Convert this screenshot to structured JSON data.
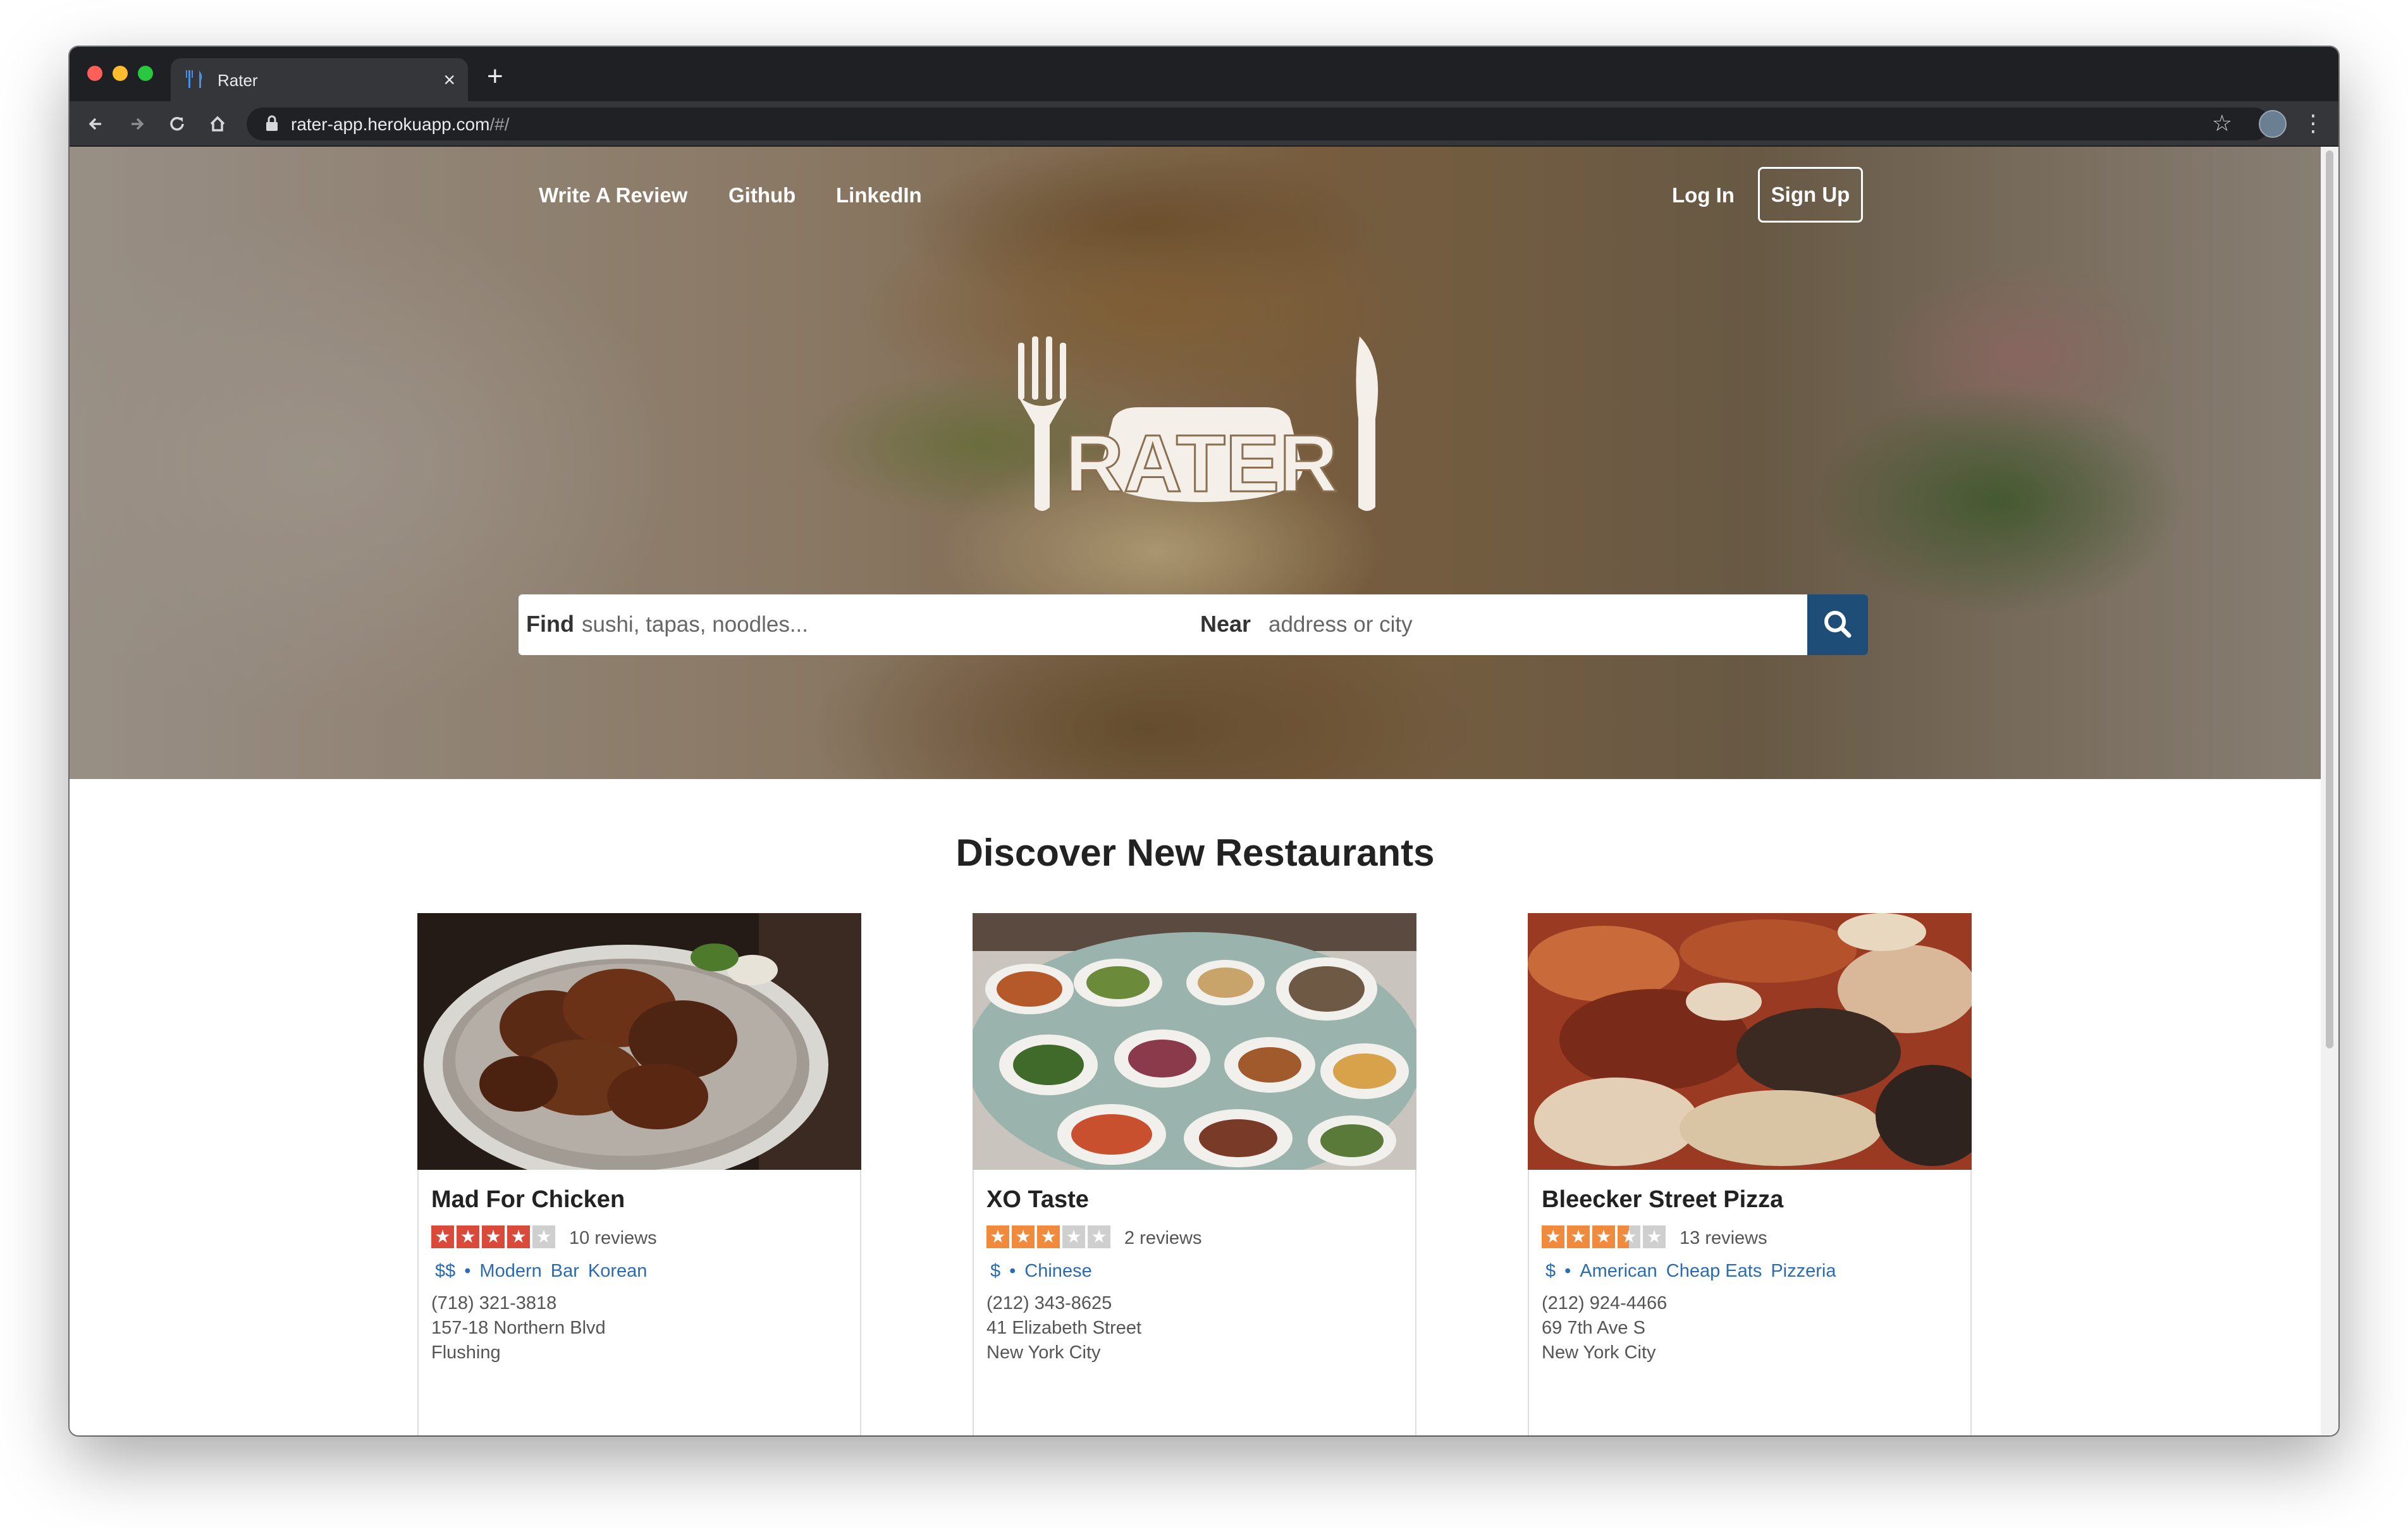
{
  "browser": {
    "tab_title": "Rater",
    "tab_close": "×",
    "new_tab": "+",
    "url_main": "rater-app.herokuapp.com",
    "url_rest": "/#/",
    "icons": {
      "back": "back-arrow-icon",
      "forward": "forward-arrow-icon",
      "reload": "reload-icon",
      "home": "home-icon",
      "lock": "lock-icon",
      "bookmark": "star-icon",
      "menu": "kebab-menu-icon"
    }
  },
  "nav": {
    "write_review": "Write A Review",
    "github": "Github",
    "linkedin": "LinkedIn",
    "login": "Log In",
    "signup": "Sign Up"
  },
  "logo": {
    "text": "RATER"
  },
  "search": {
    "find_label": "Find",
    "find_placeholder": "sushi, tapas, noodles...",
    "near_label": "Near",
    "near_placeholder": "address or city",
    "button_color": "#1e4d78"
  },
  "section_title": "Discover New Restaurants",
  "colors": {
    "link": "#2b6cb0",
    "star_red": "#d94a3a",
    "star_orange": "#f08a3c",
    "star_empty": "#cfcfcf"
  },
  "restaurants": [
    {
      "name": "Mad For Chicken",
      "rating": 4,
      "reviews": "10 reviews",
      "price": "$$",
      "separator": "•",
      "categories": [
        "Modern",
        "Bar",
        "Korean"
      ],
      "phone": "(718) 321-3818",
      "address": "157-18 Northern Blvd",
      "city": "Flushing"
    },
    {
      "name": "XO Taste",
      "rating": 3,
      "reviews": "2 reviews",
      "price": "$",
      "separator": "•",
      "categories": [
        "Chinese"
      ],
      "phone": "(212) 343-8625",
      "address": "41 Elizabeth Street",
      "city": "New York City"
    },
    {
      "name": "Bleecker Street Pizza",
      "rating": 3.5,
      "reviews": "13 reviews",
      "price": "$",
      "separator": "•",
      "categories": [
        "American",
        "Cheap Eats",
        "Pizzeria"
      ],
      "phone": "(212) 924-4466",
      "address": "69 7th Ave S",
      "city": "New York City"
    }
  ]
}
